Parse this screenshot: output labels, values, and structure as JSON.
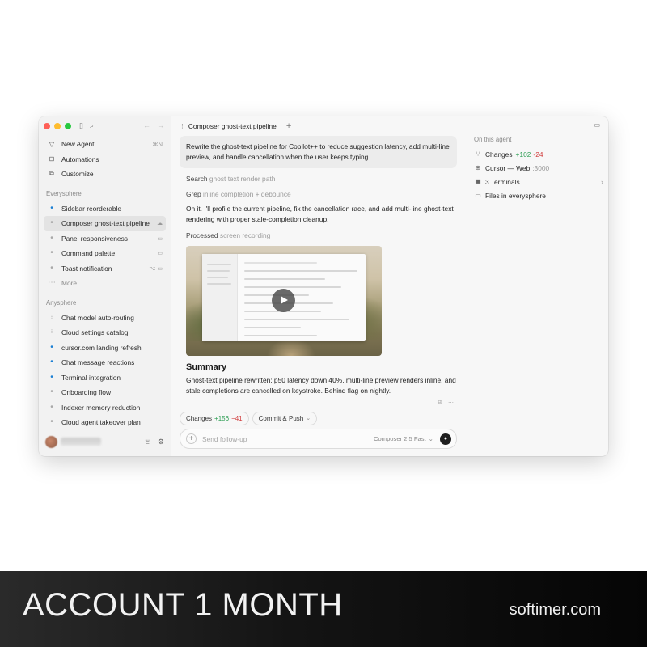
{
  "sidebar": {
    "top": [
      {
        "icon": "new-agent-icon",
        "label": "New Agent",
        "shortcut": "⌘N"
      },
      {
        "icon": "automations-icon",
        "label": "Automations"
      },
      {
        "icon": "customize-icon",
        "label": "Customize"
      }
    ],
    "section1": {
      "label": "Everysphere",
      "items": [
        {
          "label": "Sidebar reorderable",
          "status": "blue"
        },
        {
          "label": "Composer ghost-text pipeline",
          "status": "gray",
          "active": true,
          "right": "☁"
        },
        {
          "label": "Panel responsiveness",
          "status": "gray",
          "right": "▭"
        },
        {
          "label": "Command palette",
          "status": "gray",
          "right": "▭"
        },
        {
          "label": "Toast notification",
          "status": "gray",
          "right": "⌥ ▭"
        }
      ],
      "more": "More"
    },
    "section2": {
      "label": "Anysphere",
      "items": [
        {
          "label": "Chat model auto-routing",
          "status": "spin"
        },
        {
          "label": "Cloud settings catalog",
          "status": "spin"
        },
        {
          "label": "cursor.com landing refresh",
          "status": "blue"
        },
        {
          "label": "Chat message reactions",
          "status": "blue"
        },
        {
          "label": "Terminal integration",
          "status": "blue"
        },
        {
          "label": "Onboarding flow",
          "status": "gray"
        },
        {
          "label": "Indexer memory reduction",
          "status": "gray"
        },
        {
          "label": "Cloud agent takeover plan",
          "status": "gray"
        }
      ]
    }
  },
  "tab": {
    "title": "Composer ghost-text pipeline"
  },
  "chat": {
    "user_message": "Rewrite the ghost-text pipeline for Copilot++ to reduce suggestion latency, add multi-line preview, and handle cancellation when the user keeps typing",
    "step1": {
      "verb": "Search",
      "detail": "ghost text render path"
    },
    "step2": {
      "verb": "Grep",
      "detail": "inline completion + debounce"
    },
    "reply": "On it. I'll profile the current pipeline, fix the cancellation race, and add multi-line ghost-text rendering with proper stale-completion cleanup.",
    "step3": {
      "verb": "Processed",
      "detail": "screen recording"
    },
    "summary_title": "Summary",
    "summary_text": "Ghost-text pipeline rewritten: p50 latency down 40%, multi-line preview renders inline, and stale completions are cancelled on keystroke. Behind flag on nightly."
  },
  "chips": {
    "changes_label": "Changes",
    "plus": "+156",
    "minus": "−41",
    "commit_label": "Commit & Push"
  },
  "composer": {
    "placeholder": "Send follow-up",
    "model": "Composer 2.5 Fast"
  },
  "right_panel": {
    "header": "On this agent",
    "changes_label": "Changes",
    "changes_plus": "+102",
    "changes_minus": "-24",
    "browser_label": "Cursor — Web",
    "browser_port": ":3000",
    "terminals": "3 Terminals",
    "files": "Files in everysphere"
  },
  "banner": {
    "left": "ACCOUNT 1 MONTH",
    "right": "softimer.com"
  },
  "colors": {
    "blue_dot": "#1a7fd4",
    "plus": "#2e9e54",
    "minus": "#d03a3a"
  }
}
